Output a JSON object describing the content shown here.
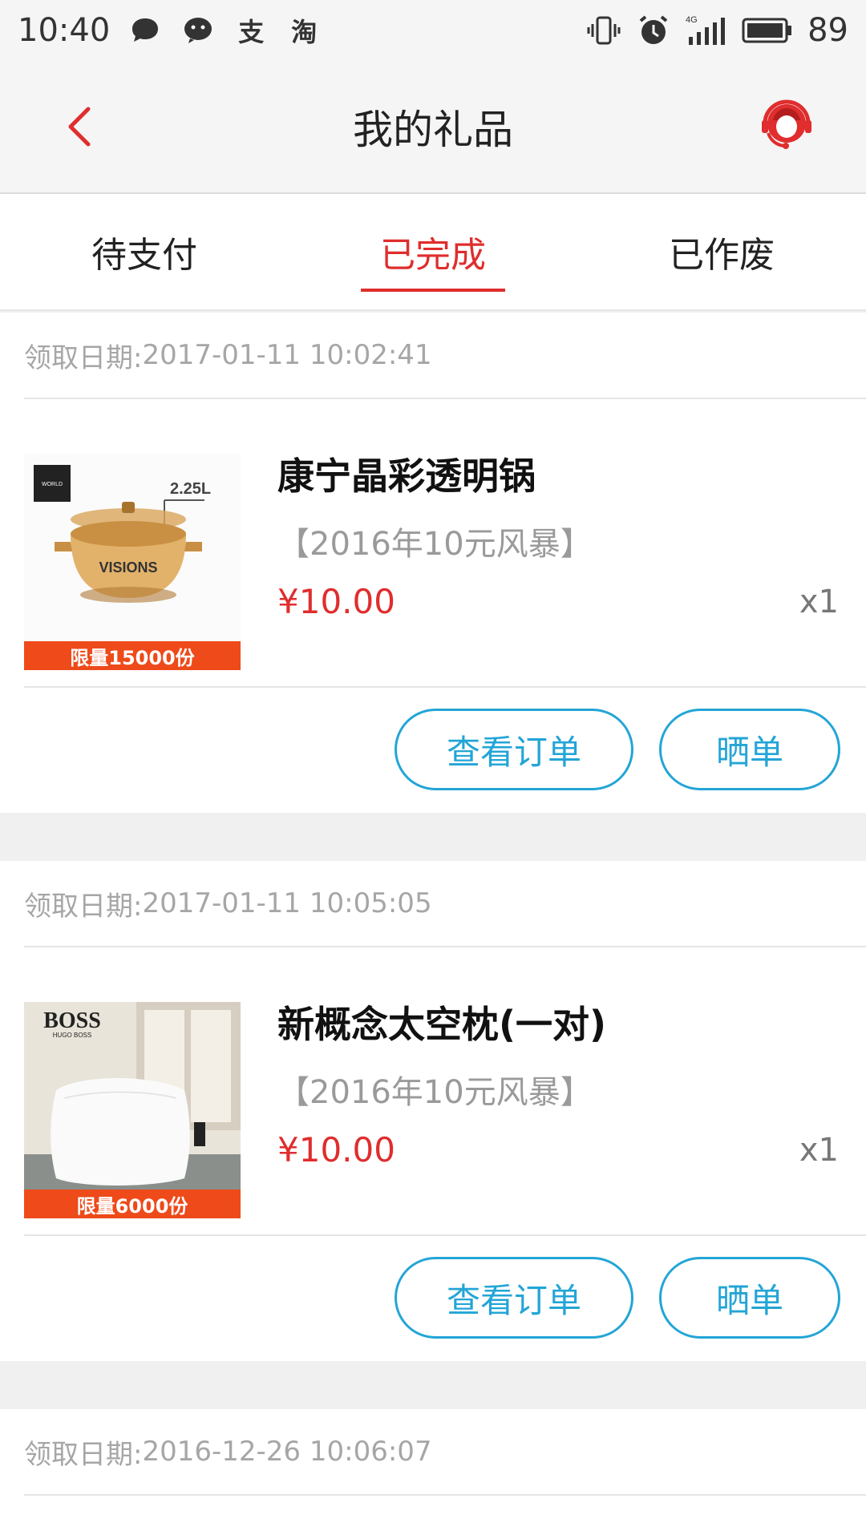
{
  "status_bar": {
    "time": "10:40",
    "notif_icons": [
      "chat-bubble-icon",
      "wechat-icon",
      "alipay-icon",
      "taobao-icon"
    ],
    "alipay_glyph": "支",
    "taobao_glyph": "淘",
    "network": "4G",
    "battery": "89"
  },
  "header": {
    "title": "我的礼品"
  },
  "tabs": [
    {
      "label": "待支付",
      "active": false
    },
    {
      "label": "已完成",
      "active": true
    },
    {
      "label": "已作废",
      "active": false
    }
  ],
  "orders": [
    {
      "date_label": "领取日期: ",
      "date": "2017-01-11 10:02:41",
      "name": "康宁晶彩透明锅",
      "campaign": "【2016年10元风暴】",
      "price": "¥10.00",
      "qty": "x1",
      "badge": "限量15000份",
      "image_text": "VISIONS",
      "capacity": "2.25L",
      "view_label": "查看订单",
      "share_label": "晒单"
    },
    {
      "date_label": "领取日期: ",
      "date": "2017-01-11 10:05:05",
      "name": "新概念太空枕(一对)",
      "campaign": "【2016年10元风暴】",
      "price": "¥10.00",
      "qty": "x1",
      "badge": "限量6000份",
      "image_text": "BOSS",
      "image_subtext": "HUGO BOSS",
      "view_label": "查看订单",
      "share_label": "晒单"
    },
    {
      "date_label": "领取日期: ",
      "date": "2016-12-26 10:06:07"
    }
  ],
  "colors": {
    "accent_red": "#e02d2d",
    "button_blue": "#23a5d6",
    "muted_gray": "#a6a6a6"
  }
}
